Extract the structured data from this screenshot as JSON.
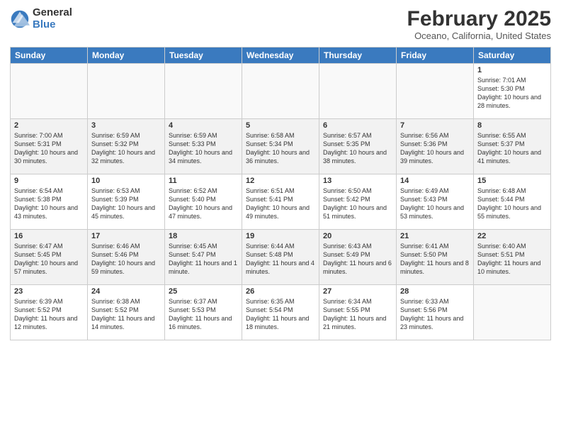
{
  "logo": {
    "general": "General",
    "blue": "Blue"
  },
  "header": {
    "month": "February 2025",
    "location": "Oceano, California, United States"
  },
  "weekdays": [
    "Sunday",
    "Monday",
    "Tuesday",
    "Wednesday",
    "Thursday",
    "Friday",
    "Saturday"
  ],
  "weeks": [
    [
      {
        "day": "",
        "info": ""
      },
      {
        "day": "",
        "info": ""
      },
      {
        "day": "",
        "info": ""
      },
      {
        "day": "",
        "info": ""
      },
      {
        "day": "",
        "info": ""
      },
      {
        "day": "",
        "info": ""
      },
      {
        "day": "1",
        "info": "Sunrise: 7:01 AM\nSunset: 5:30 PM\nDaylight: 10 hours and 28 minutes."
      }
    ],
    [
      {
        "day": "2",
        "info": "Sunrise: 7:00 AM\nSunset: 5:31 PM\nDaylight: 10 hours and 30 minutes."
      },
      {
        "day": "3",
        "info": "Sunrise: 6:59 AM\nSunset: 5:32 PM\nDaylight: 10 hours and 32 minutes."
      },
      {
        "day": "4",
        "info": "Sunrise: 6:59 AM\nSunset: 5:33 PM\nDaylight: 10 hours and 34 minutes."
      },
      {
        "day": "5",
        "info": "Sunrise: 6:58 AM\nSunset: 5:34 PM\nDaylight: 10 hours and 36 minutes."
      },
      {
        "day": "6",
        "info": "Sunrise: 6:57 AM\nSunset: 5:35 PM\nDaylight: 10 hours and 38 minutes."
      },
      {
        "day": "7",
        "info": "Sunrise: 6:56 AM\nSunset: 5:36 PM\nDaylight: 10 hours and 39 minutes."
      },
      {
        "day": "8",
        "info": "Sunrise: 6:55 AM\nSunset: 5:37 PM\nDaylight: 10 hours and 41 minutes."
      }
    ],
    [
      {
        "day": "9",
        "info": "Sunrise: 6:54 AM\nSunset: 5:38 PM\nDaylight: 10 hours and 43 minutes."
      },
      {
        "day": "10",
        "info": "Sunrise: 6:53 AM\nSunset: 5:39 PM\nDaylight: 10 hours and 45 minutes."
      },
      {
        "day": "11",
        "info": "Sunrise: 6:52 AM\nSunset: 5:40 PM\nDaylight: 10 hours and 47 minutes."
      },
      {
        "day": "12",
        "info": "Sunrise: 6:51 AM\nSunset: 5:41 PM\nDaylight: 10 hours and 49 minutes."
      },
      {
        "day": "13",
        "info": "Sunrise: 6:50 AM\nSunset: 5:42 PM\nDaylight: 10 hours and 51 minutes."
      },
      {
        "day": "14",
        "info": "Sunrise: 6:49 AM\nSunset: 5:43 PM\nDaylight: 10 hours and 53 minutes."
      },
      {
        "day": "15",
        "info": "Sunrise: 6:48 AM\nSunset: 5:44 PM\nDaylight: 10 hours and 55 minutes."
      }
    ],
    [
      {
        "day": "16",
        "info": "Sunrise: 6:47 AM\nSunset: 5:45 PM\nDaylight: 10 hours and 57 minutes."
      },
      {
        "day": "17",
        "info": "Sunrise: 6:46 AM\nSunset: 5:46 PM\nDaylight: 10 hours and 59 minutes."
      },
      {
        "day": "18",
        "info": "Sunrise: 6:45 AM\nSunset: 5:47 PM\nDaylight: 11 hours and 1 minute."
      },
      {
        "day": "19",
        "info": "Sunrise: 6:44 AM\nSunset: 5:48 PM\nDaylight: 11 hours and 4 minutes."
      },
      {
        "day": "20",
        "info": "Sunrise: 6:43 AM\nSunset: 5:49 PM\nDaylight: 11 hours and 6 minutes."
      },
      {
        "day": "21",
        "info": "Sunrise: 6:41 AM\nSunset: 5:50 PM\nDaylight: 11 hours and 8 minutes."
      },
      {
        "day": "22",
        "info": "Sunrise: 6:40 AM\nSunset: 5:51 PM\nDaylight: 11 hours and 10 minutes."
      }
    ],
    [
      {
        "day": "23",
        "info": "Sunrise: 6:39 AM\nSunset: 5:52 PM\nDaylight: 11 hours and 12 minutes."
      },
      {
        "day": "24",
        "info": "Sunrise: 6:38 AM\nSunset: 5:52 PM\nDaylight: 11 hours and 14 minutes."
      },
      {
        "day": "25",
        "info": "Sunrise: 6:37 AM\nSunset: 5:53 PM\nDaylight: 11 hours and 16 minutes."
      },
      {
        "day": "26",
        "info": "Sunrise: 6:35 AM\nSunset: 5:54 PM\nDaylight: 11 hours and 18 minutes."
      },
      {
        "day": "27",
        "info": "Sunrise: 6:34 AM\nSunset: 5:55 PM\nDaylight: 11 hours and 21 minutes."
      },
      {
        "day": "28",
        "info": "Sunrise: 6:33 AM\nSunset: 5:56 PM\nDaylight: 11 hours and 23 minutes."
      },
      {
        "day": "",
        "info": ""
      }
    ]
  ]
}
